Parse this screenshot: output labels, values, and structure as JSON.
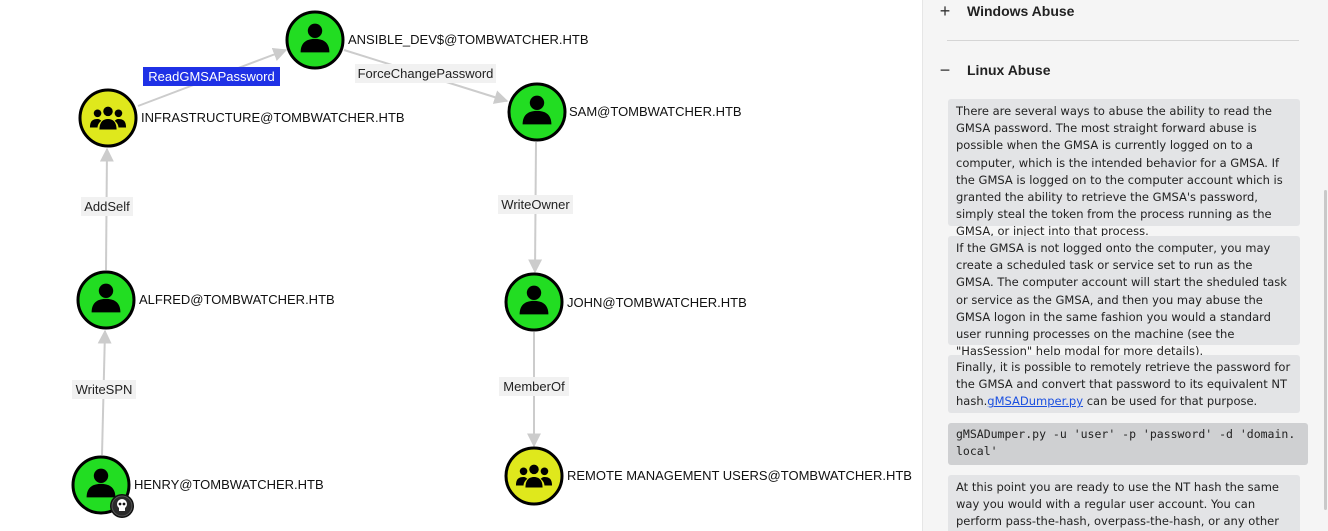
{
  "graph": {
    "nodes": {
      "ansible": {
        "label": "ANSIBLE_DEV$@TOMBWATCHER.HTB",
        "kind": "user",
        "color": "#22dd22"
      },
      "infrastructure": {
        "label": "INFRASTRUCTURE@TOMBWATCHER.HTB",
        "kind": "group",
        "color": "#dfe81c"
      },
      "sam": {
        "label": "SAM@TOMBWATCHER.HTB",
        "kind": "user",
        "color": "#22dd22"
      },
      "alfred": {
        "label": "ALFRED@TOMBWATCHER.HTB",
        "kind": "user",
        "color": "#22dd22"
      },
      "john": {
        "label": "JOHN@TOMBWATCHER.HTB",
        "kind": "user",
        "color": "#22dd22"
      },
      "henry": {
        "label": "HENRY@TOMBWATCHER.HTB",
        "kind": "user",
        "color": "#22dd22",
        "badge": "skull-icon"
      },
      "remote": {
        "label": "REMOTE MANAGEMENT USERS@TOMBWATCHER.HTB",
        "kind": "group",
        "color": "#dfe81c"
      }
    },
    "edges": {
      "read_gmsa": {
        "label": "ReadGMSAPassword",
        "selected": true
      },
      "force_change": {
        "label": "ForceChangePassword"
      },
      "add_self": {
        "label": "AddSelf"
      },
      "write_owner": {
        "label": "WriteOwner"
      },
      "write_spn": {
        "label": "WriteSPN"
      },
      "member_of": {
        "label": "MemberOf"
      }
    }
  },
  "panel": {
    "windows_abuse": {
      "toggle": "+",
      "title": "Windows Abuse"
    },
    "linux_abuse": {
      "toggle": "−",
      "title": "Linux Abuse"
    },
    "paragraphs": {
      "p1": "There are several ways to abuse the ability to read the GMSA password. The most straight forward abuse is possible when the GMSA is currently logged on to a computer, which is the intended behavior for a GMSA. If the GMSA is logged on to the computer account which is granted the ability to retrieve the GMSA's password, simply steal the token from the process running as the GMSA, or inject into that process.",
      "p2": "If the GMSA is not logged onto the computer, you may create a scheduled task or service set to run as the GMSA. The computer account will start the sheduled task or service as the GMSA, and then you may abuse the GMSA logon in the same fashion you would a standard user running processes on the machine (see the \"HasSession\" help modal for more details).",
      "p3_before": "Finally, it is possible to remotely retrieve the password for the GMSA and convert that password to its equivalent NT hash.",
      "p3_link": "gMSADumper.py",
      "p3_after": " can be used for that purpose.",
      "code": "gMSADumper.py -u 'user' -p 'password' -d 'domain.local'",
      "p4": "At this point you are ready to use the NT hash the same way you would with a regular user account. You can perform pass-the-hash, overpass-the-hash, or any other technique that takes"
    }
  },
  "colors": {
    "selected_edge": "#1f31e6",
    "edge": "#cccccc",
    "user_node": "#22dd22",
    "group_node": "#dfe81c"
  }
}
